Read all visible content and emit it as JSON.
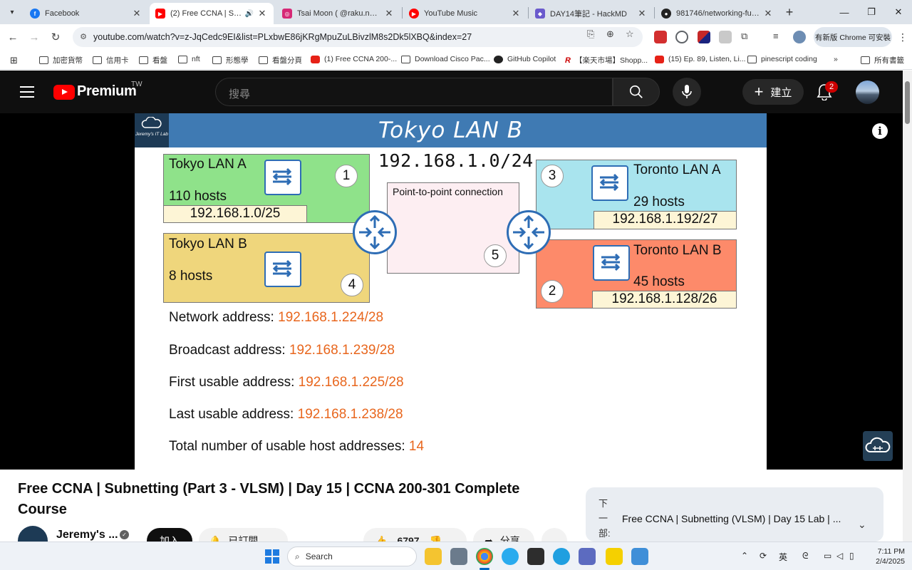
{
  "browser": {
    "tabs": [
      {
        "title": "Facebook",
        "active": false,
        "color": "#1877f2"
      },
      {
        "title": "(2) Free CCNA | Subnet",
        "active": true,
        "color": "#ff0000",
        "audio": true
      },
      {
        "title": "Tsai Moon ( @raku.nene )",
        "active": false,
        "color": "#d62976"
      },
      {
        "title": "YouTube Music",
        "active": false,
        "color": "#ff0000"
      },
      {
        "title": "DAY14筆記 - HackMD",
        "active": false,
        "color": "#6a5acd"
      },
      {
        "title": "981746/networking-funda",
        "active": false,
        "color": "#222222"
      }
    ],
    "url": "youtube.com/watch?v=z-JqCedc9EI&list=PLxbwE86jKRgMpuZuLBivzlM8s2Dk5lXBQ&index=27",
    "update_label": "有新版 Chrome 可安裝",
    "bookmarks": [
      {
        "label": "加密貨幣",
        "icon": "folder"
      },
      {
        "label": "信用卡",
        "icon": "folder"
      },
      {
        "label": "看盤",
        "icon": "folder"
      },
      {
        "label": "nft",
        "icon": "folder"
      },
      {
        "label": "形態學",
        "icon": "folder"
      },
      {
        "label": "看盤分頁",
        "icon": "folder"
      },
      {
        "label": "(1) Free CCNA 200-...",
        "icon": "youtube"
      },
      {
        "label": "Download Cisco Pac...",
        "icon": "doc"
      },
      {
        "label": "GitHub Copilot",
        "icon": "github"
      },
      {
        "label": "【楽天市場】Shopp...",
        "icon": "rakuten"
      },
      {
        "label": "(15) Ep. 89, Listen, Li...",
        "icon": "youtube"
      },
      {
        "label": "pinescript coding",
        "icon": "folder"
      }
    ],
    "bookmarks_overflow": "»",
    "all_bookmarks": "所有書籤"
  },
  "youtube": {
    "logo_text": "Premium",
    "region": "TW",
    "search_placeholder": "搜尋",
    "create_label": "建立",
    "notification_count": "2"
  },
  "slide": {
    "brand": "Jeremy's IT Lab",
    "title": "Tokyo LAN B",
    "subnet": "192.168.1.0/24",
    "p2p_label": "Point-to-point connection",
    "lans": [
      {
        "name": "Tokyo LAN A",
        "hosts": "110 hosts",
        "addr": "192.168.1.0/25",
        "num": "1",
        "color": "#8fe28a"
      },
      {
        "name": "Tokyo LAN B",
        "hosts": "8 hosts",
        "addr": "",
        "num": "4",
        "color": "#efd67c"
      },
      {
        "name": "Toronto LAN A",
        "hosts": "29 hosts",
        "addr": "192.168.1.192/27",
        "num": "3",
        "color": "#a9e4ee"
      },
      {
        "name": "Toronto LAN B",
        "hosts": "45 hosts",
        "addr": "192.168.1.128/26",
        "num": "2",
        "color": "#fd8a6a"
      }
    ],
    "p2p_num": "5",
    "info": [
      {
        "label": "Network address: ",
        "value": "192.168.1.224/28"
      },
      {
        "label": "Broadcast address: ",
        "value": "192.168.1.239/28"
      },
      {
        "label": "First usable address: ",
        "value": "192.168.1.225/28"
      },
      {
        "label": "Last usable address: ",
        "value": "192.168.1.238/28"
      },
      {
        "label": "Total number of usable host addresses: ",
        "value": "14"
      }
    ]
  },
  "video": {
    "title": "Free CCNA | Subnetting (Part 3 - VLSM) | Day 15 | CCNA 200-301 Complete Course",
    "channel": "Jeremy's ...",
    "join_label": "加入",
    "subscribed_label": "已訂閱",
    "likes": "6797",
    "share_label": "分享",
    "up_next_label": "下一部:",
    "up_next_title": "Free CCNA | Subnetting (VLSM) | Day 15 Lab | ..."
  },
  "taskbar": {
    "search_label": "Search",
    "ime_label": "英",
    "time": "7:11 PM",
    "date": "2/4/2025"
  }
}
